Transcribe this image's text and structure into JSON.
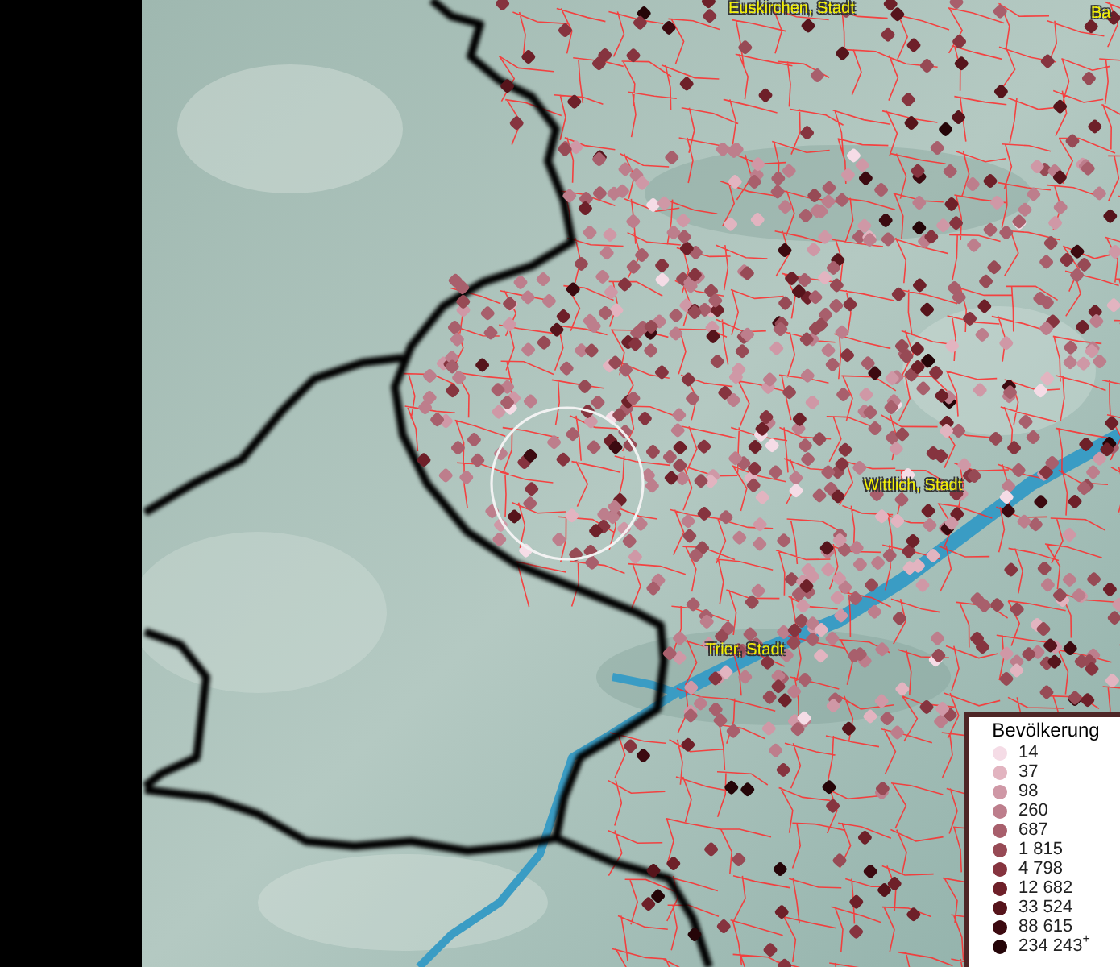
{
  "map": {
    "place_labels": [
      {
        "text": "Euskirchen, Stadt"
      },
      {
        "text": "Ba"
      },
      {
        "text": "Wittlich, Stadt"
      },
      {
        "text": "Trier, Stadt"
      }
    ]
  },
  "legend": {
    "title": "Bevölkerung",
    "items": [
      {
        "label": "14",
        "color": "#f5dce6"
      },
      {
        "label": "37",
        "color": "#e2b4c0"
      },
      {
        "label": "98",
        "color": "#cf98a6"
      },
      {
        "label": "260",
        "color": "#bd7e8c"
      },
      {
        "label": "687",
        "color": "#a85f6c"
      },
      {
        "label": "1 815",
        "color": "#974a55"
      },
      {
        "label": "4 798",
        "color": "#86343f"
      },
      {
        "label": "12 682",
        "color": "#6e2029"
      },
      {
        "label": "33 524",
        "color": "#56141b"
      },
      {
        "label": "88 615",
        "color": "#3c0a10"
      },
      {
        "label": "234 243$^{+}$",
        "color": "#250508"
      }
    ]
  }
}
